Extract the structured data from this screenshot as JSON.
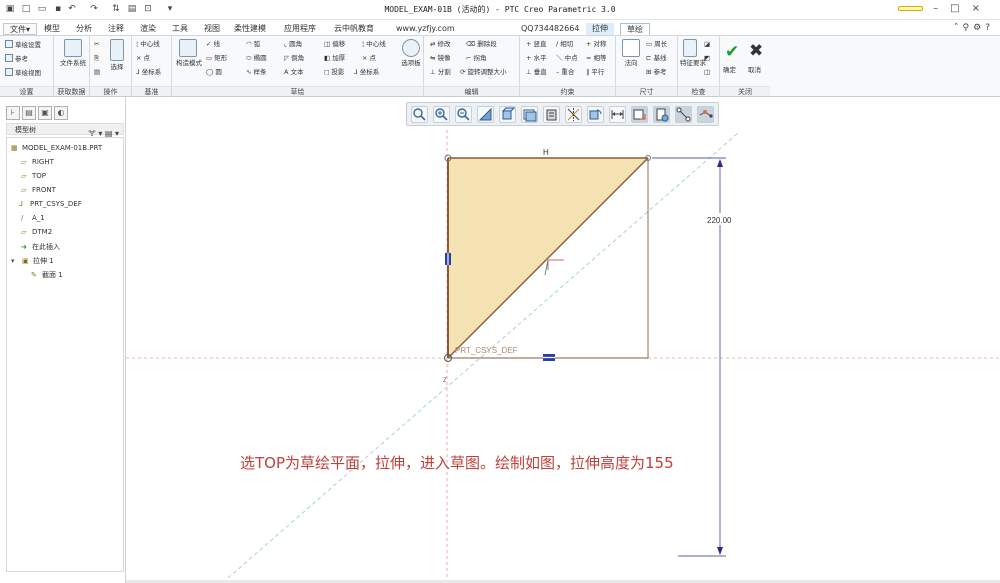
{
  "window": {
    "title": "MODEL_EXAM-01B (活动的) - PTC Creo Parametric 3.0"
  },
  "menu": {
    "items": [
      "文件",
      "模型",
      "分析",
      "注释",
      "渲染",
      "工具",
      "视图",
      "柔性建模",
      "应用程序",
      "云中帆教育",
      "www.yzfjy.com",
      "QQ734482664",
      "拉伸",
      "草绘"
    ],
    "file_label": "文件",
    "file_arrow": "▾"
  },
  "ribbon": {
    "groups": {
      "settings": "设置",
      "get_data": "获取数据",
      "operations": "操作",
      "datum": "基准",
      "sketch": "草绘",
      "edit": "编辑",
      "constrain": "约束",
      "dimension": "尺寸",
      "inspect": "检查",
      "close": "关闭"
    },
    "buttons": {
      "sketch_setup": "草绘设置",
      "reference": "参考",
      "sketch_view": "草绘视图",
      "file_system": "文件系统",
      "select": "选择",
      "centerline": "中心线",
      "point": "点",
      "coord_sys": "坐标系",
      "construction_mode": "构造模式",
      "line": "线",
      "rectangle": "矩形",
      "circle": "圆",
      "arc": "弧",
      "ellipse": "椭圆",
      "spline": "样条",
      "fillet": "圆角",
      "chamfer": "倒角",
      "text": "文本",
      "offset": "偏移",
      "thicken": "加厚",
      "project": "投影",
      "centerline2": "中心线",
      "point2": "点",
      "coord_sys2": "坐标系",
      "palette": "选项板",
      "modify": "修改",
      "delete_segment": "删除段",
      "mirror": "镜像",
      "corner": "拐角",
      "divide": "分割",
      "rotate_resize": "旋转调整大小",
      "vertical": "竖直",
      "tangent": "相切",
      "symmetric": "对称",
      "horizontal": "水平",
      "midpoint": "中点",
      "equal": "相等",
      "perpendicular": "垂直",
      "coincident": "重合",
      "parallel": "平行",
      "normal": "法向",
      "perimeter": "周长",
      "baseline": "基线",
      "reference_dim": "参考",
      "feature_req": "特征要求",
      "ok": "确定",
      "cancel": "取消"
    }
  },
  "model_tree": {
    "header": "模型树",
    "items": [
      {
        "icon": "part-icon",
        "label": "MODEL_EXAM-01B.PRT"
      },
      {
        "icon": "datum-plane-icon",
        "label": "RIGHT"
      },
      {
        "icon": "datum-plane-icon",
        "label": "TOP"
      },
      {
        "icon": "datum-plane-icon",
        "label": "FRONT"
      },
      {
        "icon": "csys-icon",
        "label": "PRT_CSYS_DEF"
      },
      {
        "icon": "axis-icon",
        "label": "A_1"
      },
      {
        "icon": "datum-plane-icon",
        "label": "DTM2"
      },
      {
        "icon": "insert-here-icon",
        "label": "在此插入"
      },
      {
        "icon": "extrude-icon",
        "label": "拉伸 1"
      },
      {
        "icon": "section-icon",
        "label": "截面 1"
      }
    ]
  },
  "sketch": {
    "dim_h_label": "H",
    "dim_vertical_value": "220.00",
    "csys_label": "PRT_CSYS_DEF",
    "axis_label": "Z",
    "fill_color": "#f6e3b3",
    "outline_color": "#8a5a3c"
  },
  "instruction": {
    "text": "选TOP为草绘平面，拉伸，进入草图。绘制如图，拉伸高度为155"
  }
}
